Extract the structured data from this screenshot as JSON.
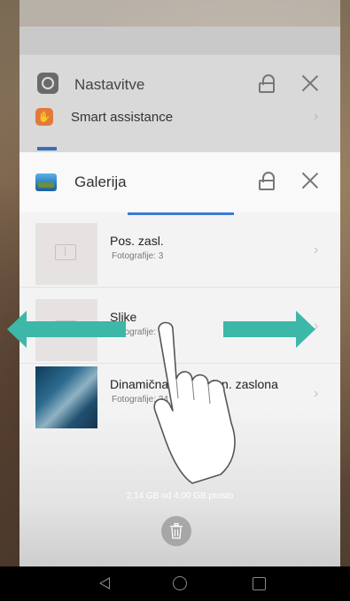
{
  "recents": {
    "background_card": {
      "title": "Nastavitve",
      "subitem": "Smart assistance"
    },
    "foreground_card": {
      "title": "Galerija",
      "albums": [
        {
          "name": "Pos. zasl.",
          "count": "Fotografije: 3"
        },
        {
          "name": "Slike",
          "count": "Fotografije: 7"
        },
        {
          "name": "Dinamična o... zaklen. zaslona",
          "count": "Fotografije: 24"
        }
      ]
    },
    "storage_text": "2,14 GB od 4,00 GB prosto"
  },
  "navbar": {
    "icons": [
      "back-icon",
      "home-icon",
      "recent-apps-icon"
    ]
  },
  "colors": {
    "arrow": "#3db7a8",
    "tab_indicator": "#3a7bd5"
  }
}
